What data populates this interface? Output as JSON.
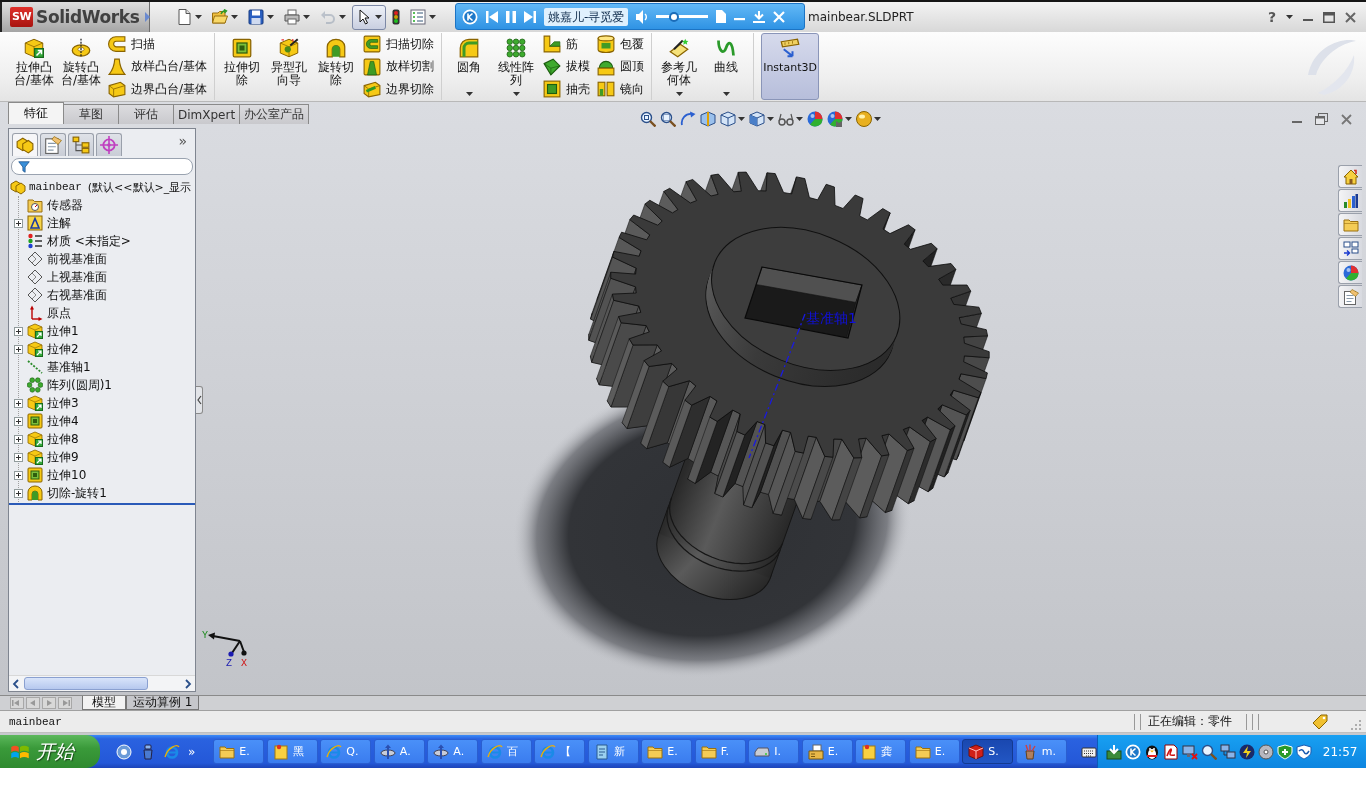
{
  "window": {
    "title": "mainbear.SLDPRT",
    "help": "?"
  },
  "app_logo": {
    "mark": "SW",
    "name": "SolidWorks"
  },
  "quick_access": [
    {
      "kind": "new",
      "dropdown": true,
      "pressed": false,
      "disabled": false
    },
    {
      "kind": "open",
      "dropdown": true,
      "pressed": false,
      "disabled": false
    },
    {
      "kind": "save",
      "dropdown": true,
      "pressed": false,
      "disabled": false
    },
    {
      "kind": "print",
      "dropdown": true,
      "pressed": false,
      "disabled": false
    },
    {
      "kind": "undo",
      "dropdown": true,
      "pressed": false,
      "disabled": true
    },
    {
      "kind": "select",
      "dropdown": true,
      "pressed": true,
      "disabled": false
    },
    {
      "kind": "rebuild",
      "dropdown": false,
      "pressed": false,
      "disabled": false
    },
    {
      "kind": "options",
      "dropdown": true,
      "pressed": false,
      "disabled": false
    }
  ],
  "media_player": {
    "track": "姚嘉儿-寻觅爱",
    "volume": {
      "level": 0.3
    }
  },
  "command_manager": {
    "groups": [
      {
        "columns": [
          {
            "items": [
              {
                "kind": "extrude-boss",
                "label": "拉伸凸台/基体",
                "dropdown": false
              }
            ]
          },
          {
            "items": [
              {
                "kind": "revolve-boss",
                "label": "旋转凸台/基体",
                "dropdown": false
              }
            ]
          },
          {
            "items": [
              {
                "kind": "sweep",
                "label": "扫描",
                "dropdown": false
              },
              {
                "kind": "loft",
                "label": "放样凸台/基体",
                "dropdown": false
              },
              {
                "kind": "boundary",
                "label": "边界凸台/基体",
                "dropdown": false
              }
            ]
          }
        ]
      },
      {
        "columns": [
          {
            "items": [
              {
                "kind": "extrude-cut",
                "label": "拉伸切除",
                "dropdown": false
              }
            ]
          },
          {
            "items": [
              {
                "kind": "hole-wizard",
                "label": "异型孔向导",
                "dropdown": false
              }
            ]
          },
          {
            "items": [
              {
                "kind": "revolve-cut",
                "label": "旋转切除",
                "dropdown": false
              }
            ]
          },
          {
            "items": [
              {
                "kind": "sweep-cut",
                "label": "扫描切除",
                "dropdown": false
              },
              {
                "kind": "loft-cut",
                "label": "放样切割",
                "dropdown": false
              },
              {
                "kind": "boundary-cut",
                "label": "边界切除",
                "dropdown": false
              }
            ]
          }
        ]
      },
      {
        "columns": [
          {
            "items": [
              {
                "kind": "fillet",
                "label": "圆角",
                "dropdown": true
              }
            ]
          },
          {
            "items": [
              {
                "kind": "linear-pattern",
                "label": "线性阵列",
                "dropdown": true
              }
            ]
          },
          {
            "items": [
              {
                "kind": "rib",
                "label": "筋",
                "dropdown": false
              },
              {
                "kind": "draft",
                "label": "拔模",
                "dropdown": false
              },
              {
                "kind": "shell",
                "label": "抽壳",
                "dropdown": false
              }
            ]
          },
          {
            "items": [
              {
                "kind": "wrap",
                "label": "包覆",
                "dropdown": false
              },
              {
                "kind": "dome",
                "label": "圆顶",
                "dropdown": false
              },
              {
                "kind": "mirror",
                "label": "镜向",
                "dropdown": false
              }
            ]
          }
        ]
      },
      {
        "columns": [
          {
            "items": [
              {
                "kind": "reference-geometry",
                "label": "参考几何体",
                "dropdown": true
              }
            ]
          },
          {
            "items": [
              {
                "kind": "curves",
                "label": "曲线",
                "dropdown": true
              }
            ]
          }
        ]
      }
    ],
    "instant3d": {
      "label": "Instant3D",
      "on": true
    }
  },
  "ribbon_tabs": [
    {
      "label": "特征",
      "selected": true
    },
    {
      "label": "草图",
      "selected": false
    },
    {
      "label": "评估",
      "selected": false
    },
    {
      "label": "DimXpert",
      "selected": false
    },
    {
      "label": "办公室产品",
      "selected": false
    }
  ],
  "feature_manager": {
    "tabs": [
      {
        "kind": "feature-tree",
        "selected": true
      },
      {
        "kind": "property",
        "selected": false
      },
      {
        "kind": "configuration",
        "selected": false
      },
      {
        "kind": "dimxpert",
        "selected": false
      }
    ],
    "more": "»",
    "tree": {
      "root": {
        "name": "mainbear",
        "config": "(默认<<默认>_显示",
        "children": [
          {
            "label": "传感器",
            "kind": "sensors"
          },
          {
            "label": "注解",
            "kind": "annotations",
            "expanded": false
          },
          {
            "label": "材质 <未指定>",
            "kind": "material"
          },
          {
            "label": "前视基准面",
            "kind": "plane"
          },
          {
            "label": "上视基准面",
            "kind": "plane"
          },
          {
            "label": "右视基准面",
            "kind": "plane"
          },
          {
            "label": "原点",
            "kind": "origin"
          },
          {
            "label": "拉伸1",
            "kind": "extrude",
            "expanded": false
          },
          {
            "label": "拉伸2",
            "kind": "extrude",
            "expanded": false
          },
          {
            "label": "基准轴1",
            "kind": "axis"
          },
          {
            "label": "阵列(圆周)1",
            "kind": "circular-pattern"
          },
          {
            "label": "拉伸3",
            "kind": "extrude",
            "expanded": false
          },
          {
            "label": "拉伸4",
            "kind": "cut-extrude",
            "expanded": false
          },
          {
            "label": "拉伸8",
            "kind": "extrude",
            "expanded": false
          },
          {
            "label": "拉伸9",
            "kind": "extrude",
            "expanded": false
          },
          {
            "label": "拉伸10",
            "kind": "cut-extrude",
            "expanded": false
          },
          {
            "label": "切除-旋转1",
            "kind": "cut-revolve",
            "expanded": false
          }
        ]
      }
    }
  },
  "view_toolbar": [
    {
      "kind": "zoom-fit",
      "dropdown": false
    },
    {
      "kind": "zoom-area",
      "dropdown": false
    },
    {
      "kind": "previous-view",
      "dropdown": false
    },
    {
      "kind": "section-view",
      "dropdown": false
    },
    {
      "kind": "view-orientation",
      "dropdown": true
    },
    {
      "kind": "display-style",
      "dropdown": true
    },
    {
      "kind": "hide-show",
      "dropdown": true
    },
    {
      "kind": "edit-appearance",
      "dropdown": false
    },
    {
      "kind": "apply-scene",
      "dropdown": true
    },
    {
      "kind": "view-settings",
      "dropdown": true
    }
  ],
  "viewport": {
    "axis_label": "基准轴1",
    "triad": {
      "y": "Y",
      "z": "Z",
      "x": "X"
    }
  },
  "task_pane": [
    {
      "kind": "home"
    },
    {
      "kind": "resources"
    },
    {
      "kind": "file-explorer"
    },
    {
      "kind": "view-palette"
    },
    {
      "kind": "appearances"
    },
    {
      "kind": "custom-properties"
    }
  ],
  "bottom_tabs": [
    {
      "label": "模型",
      "selected": true
    },
    {
      "label": "运动算例 1",
      "selected": false
    }
  ],
  "status_bar": {
    "document": "mainbear",
    "mode": "正在编辑：零件"
  },
  "taskbar": {
    "start": "开始",
    "quick_launch": [
      {
        "kind": "desktop"
      },
      {
        "kind": "media"
      },
      {
        "kind": "browser"
      }
    ],
    "more": "»",
    "tasks": [
      {
        "label": "E.",
        "kind": "folder",
        "selected": false
      },
      {
        "label": "黑",
        "kind": "note",
        "selected": false
      },
      {
        "label": "Q.",
        "kind": "browser",
        "selected": false
      },
      {
        "label": "A.",
        "kind": "tool",
        "selected": false
      },
      {
        "label": "A.",
        "kind": "tool",
        "selected": false
      },
      {
        "label": "百",
        "kind": "browser",
        "selected": false
      },
      {
        "label": "【",
        "kind": "browser",
        "selected": false
      },
      {
        "label": "新",
        "kind": "notepad",
        "selected": false
      },
      {
        "label": "E.",
        "kind": "folder",
        "selected": false
      },
      {
        "label": "F.",
        "kind": "folder",
        "selected": false
      },
      {
        "label": "I.",
        "kind": "drive",
        "selected": false
      },
      {
        "label": "E.",
        "kind": "fax",
        "selected": false
      },
      {
        "label": "龚",
        "kind": "note",
        "selected": false
      },
      {
        "label": "E.",
        "kind": "folder",
        "selected": false
      },
      {
        "label": "S.",
        "kind": "solidworks",
        "selected": true
      },
      {
        "label": "m.",
        "kind": "paint",
        "selected": false
      }
    ],
    "tray": [
      {
        "kind": "update"
      },
      {
        "kind": "k-player"
      },
      {
        "kind": "chat"
      },
      {
        "kind": "pdf"
      },
      {
        "kind": "network"
      },
      {
        "kind": "search"
      },
      {
        "kind": "computers"
      },
      {
        "kind": "power"
      },
      {
        "kind": "disc"
      },
      {
        "kind": "security"
      },
      {
        "kind": "shield"
      }
    ],
    "clock": "21:57"
  }
}
